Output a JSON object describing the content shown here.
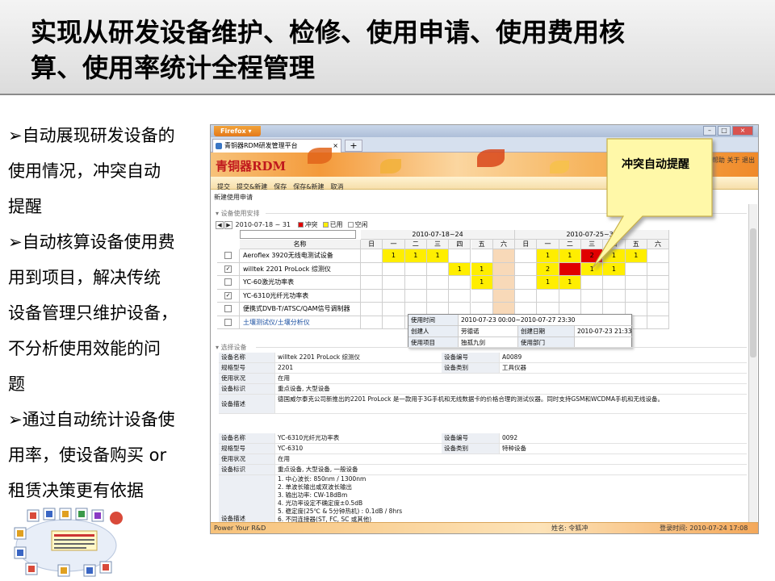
{
  "slide": {
    "title_line1": "实现从研发设备维护、检修、使用申请、使用费用核",
    "title_line2": "算、使用率统计全程管理"
  },
  "bullets": [
    "➢自动展现研发设备的",
    "使用情况，冲突自动",
    "提醒",
    "➢自动核算设备使用费",
    "用到项目，解决传统",
    "设备管理只维护设备，",
    "不分析使用效能的问",
    "题",
    "➢通过自动统计设备使",
    "用率，使设备购买 or",
    "租赁决策更有依据"
  ],
  "browser": {
    "firefox_label": "Firefox",
    "tab_title": "青铜器RDM研发管理平台",
    "new_tab": "+",
    "window_controls": [
      "–",
      "□",
      "×"
    ]
  },
  "app": {
    "logo": "青铜器RDM",
    "top_links": "帮助   关于   退出",
    "toolbar": [
      "提交",
      "提交&新建",
      "保存",
      "保存&新建",
      "取消"
    ],
    "breadcrumb": "新建使用申请",
    "section_schedule": "设备使用安排",
    "section_selected": "选择设备",
    "date_range": "2010-07-18 ~ 31",
    "legend": [
      {
        "label": "冲突",
        "color": "#e00000"
      },
      {
        "label": "已用",
        "color": "#ffee00"
      },
      {
        "label": "空闲",
        "color": "#ffffff"
      }
    ],
    "col_name_header": "名称",
    "weeks": [
      "2010-07-18~24",
      "2010-07-25~31"
    ],
    "weekdays": [
      "日",
      "一",
      "二",
      "三",
      "四",
      "五",
      "六"
    ],
    "rows": [
      {
        "checked": false,
        "name": "Aeroflex 3920无线电测试设备",
        "cells": [
          "",
          "1",
          "1",
          "1",
          "",
          "",
          "w",
          "",
          "1",
          "1",
          "2c",
          "1",
          "1",
          ""
        ]
      },
      {
        "checked": true,
        "name": "willtek 2201 ProLock 综测仪",
        "cells": [
          "",
          "",
          "",
          "",
          "1",
          "1",
          "w",
          "",
          "2",
          "c",
          "1",
          "1",
          "",
          ""
        ]
      },
      {
        "checked": false,
        "name": "YC-60激光功率表",
        "cells": [
          "",
          "",
          "",
          "",
          "",
          "1",
          "w",
          "",
          "1",
          "1",
          "",
          "",
          "",
          ""
        ]
      },
      {
        "checked": true,
        "name": "YC-6310光纤光功率表",
        "cells": [
          "",
          "",
          "",
          "",
          "",
          "",
          "w",
          "",
          "",
          "",
          "",
          "",
          "",
          ""
        ]
      },
      {
        "checked": false,
        "name": "便携式DVB-T/ATSC/QAM信号调制器",
        "cells": [
          "",
          "",
          "",
          "",
          "",
          "",
          "w",
          "",
          "",
          "",
          "",
          "",
          "",
          ""
        ]
      },
      {
        "checked": false,
        "name": "土壤测试仪/土壤分析仪",
        "link": true,
        "cells": [
          "",
          "",
          "",
          "",
          "",
          "",
          "",
          "",
          "",
          "",
          "",
          "",
          "",
          ""
        ]
      }
    ],
    "popup": {
      "use_time_label": "使用时间",
      "use_time": "2010-07-23 00:00~2010-07-27 23:30",
      "creator_label": "创建人",
      "creator": "劳德诺",
      "create_date_label": "创建日期",
      "create_date": "2010-07-23 21:33",
      "project_label": "使用项目",
      "project": "独孤九剑",
      "dept_label": "使用部门",
      "dept": ""
    },
    "devices": [
      {
        "name_label": "设备名称",
        "name": "willtek 2201 ProLock 综测仪",
        "code_label": "设备编号",
        "code": "A0089",
        "model_label": "规格型号",
        "model": "2201",
        "type_label": "设备类别",
        "type": "工具仪器",
        "status_label": "使用状况",
        "status": "在用",
        "tag_label": "设备标识",
        "tag": "重点设备, 大型设备",
        "desc_label": "设备描述",
        "desc": "德国威尔泰克公司新推出的2201 ProLock 是一款用于3G手机和无线数据卡的价格合理的测试仪器。同时支持GSM和WCDMA手机和无线设备。"
      },
      {
        "name_label": "设备名称",
        "name": "YC-6310光纤光功率表",
        "code_label": "设备编号",
        "code": "0092",
        "model_label": "规格型号",
        "model": "YC-6310",
        "type_label": "设备类别",
        "type": "特种设备",
        "status_label": "使用状况",
        "status": "在用",
        "tag_label": "设备标识",
        "tag": "重点设备, 大型设备, 一般设备",
        "desc_label": "设备描述",
        "desc_lines": [
          "1. 中心波长: 850nm / 1300nm",
          "2. 单波长输出或双波长输出",
          "3. 输出功率: CW-18dBm",
          "4. 光功率设定不确定度±0.5dB",
          "5. 稳定度(25℃ & 5分钟热机) : 0.1dB / 8hrs",
          "6. 不同连接器(ST, FC, SC 或其他)"
        ]
      }
    ],
    "status_bar": {
      "left": "Power Your R&D",
      "user": "姓名: 令狐冲",
      "login": "登录时间: 2010-07-24 17:08"
    }
  },
  "callout": {
    "text": "冲突自动提醒"
  },
  "colors": {
    "conflict": "#e00000",
    "used": "#ffee00",
    "weekend": "#f8d9b8",
    "accent_red": "#c0181d"
  }
}
